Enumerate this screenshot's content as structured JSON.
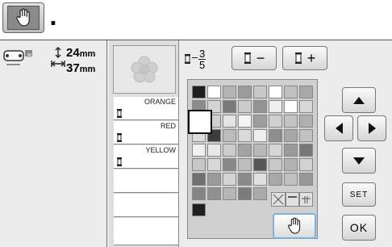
{
  "top_hand_icon": "hand-icon",
  "period": ".",
  "size": {
    "height": "24",
    "width": "37",
    "unit": "mm"
  },
  "frac": {
    "numerator": "3",
    "denominator": "5"
  },
  "threads": [
    "ORANGE",
    "RED",
    "YELLOW"
  ],
  "buttons": {
    "minus": "−",
    "plus": "+",
    "set": "SET",
    "ok": "OK"
  },
  "palette_rows": [
    [
      "#1e1e1e",
      "#ffffff",
      "#b4b4b4",
      "#9c9c9c",
      "#c8c8c8",
      "#ffffff",
      "#c0c0c0",
      "#a8a8a8"
    ],
    [
      "#8c8c8c",
      "#d4d4d4",
      "#7a7a7a",
      "#cbcbcb",
      "#949494",
      "#eeeeee",
      "#ffffff",
      "#d8d8d8"
    ],
    [
      "#ffffff",
      "#cfcfcf",
      "#e4e4e4",
      "#f4f4f4",
      "#9e9e9e",
      "#d0d0d0",
      "#c4c4c4",
      "#b0b0b0"
    ],
    [
      "#dcdcdc",
      "#3c3c3c",
      "#bcbcbc",
      "#dadada",
      "#efefef",
      "#8e8e8e",
      "#a6a6a6",
      "#c2c2c2"
    ],
    [
      "#f0f0f0",
      "#e8e8e8",
      "#cccccc",
      "#a2a2a2",
      "#b8b8b8",
      "#d6d6d6",
      "#9a9a9a",
      "#787878"
    ],
    [
      "#c6c6c6",
      "#d8d8d8",
      "#888888",
      "#bebebe",
      "#585858",
      "#c8c8c8",
      "#b2b2b2",
      "#d2d2d2"
    ],
    [
      "#707070",
      "#9a9a9a",
      "#d4d4d4",
      "#8a8a8a",
      "#e0e0e0",
      "#a8a8a8",
      "#c0c0c0",
      "#989898"
    ],
    [
      "#848484",
      "#909090",
      "#b6b6b6",
      "#7c7c7c",
      "#aaaaaa",
      "#ffffff",
      "#ffffff",
      "#e4e4e4"
    ],
    [
      "#202020"
    ]
  ]
}
